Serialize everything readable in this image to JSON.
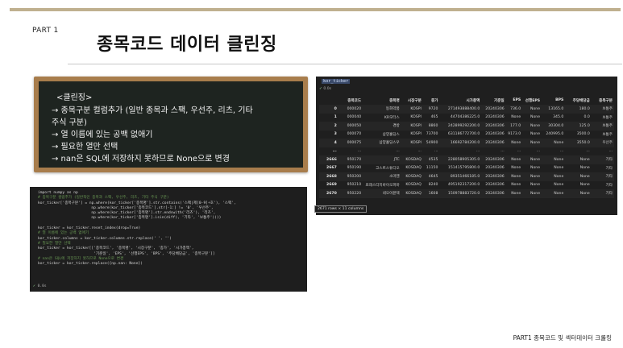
{
  "header": {
    "part": "PART 1",
    "title": "종목코드 데이터 클린징"
  },
  "board": {
    "lines": [
      "<클린징>",
      "→ 종목구분 컬럼추가 (일반 종목과 스팩, 우선주, 리츠, 기타",
      "주식 구분)",
      "→ 열 이름에 있는 공백 없애기",
      "→ 필요한 열만 선택",
      "→ nan은 SQL에 저장하지 못하므로 None으로 변경"
    ]
  },
  "code": {
    "lines": [
      "import numpy as np",
      "# 종목구분 컬럼추가 (일반적인 종목과 스팩, 우선주, 리츠, 기타 주식 구분)",
      "kor_ticker['종목구분'] = np.where(kor_ticker['종목명'].str.contains('스팩|제[0-9]+호'), '스팩',",
      "                        np.where(kor_ticker['종목코드'].str[-1:] != '0', '우선주',",
      "                        np.where(kor_ticker['종목명'].str.endswith('리츠'), '리츠',",
      "                        np.where(kor_ticker['종목명'].isin(diff), '기타', '보통주'))))",
      "",
      "kor_ticker = kor_ticker.reset_index(drop=True)",
      "# 열 이름에 있는 공백 없애기",
      "kor_ticker.columns = kor_ticker.columns.str.replace(' ', '')",
      "# 필요한 열만 선택",
      "kor_ticker = kor_ticker[['종목코드', '종목명', '시장구분', '종가', '시가총액',",
      "                         '기준일', 'EPS', '선행EPS', 'BPS', '주당배당금', '종목구분']]",
      "# nan은 SQL에 저장하지 못하므로 None으로 변경",
      "kor_ticker = kor_ticker.replace({np.nan: None})"
    ],
    "comment_lines": [
      1,
      8,
      10,
      13
    ],
    "status_check": "✓",
    "status_time": "0.0s"
  },
  "dataframe": {
    "cell_label": "kor_ticker",
    "status_check": "✓",
    "status_time": "0.0s",
    "columns": [
      "",
      "종목코드",
      "종목명",
      "시장구분",
      "종가",
      "시가총액",
      "기준일",
      "EPS",
      "선행EPS",
      "BPS",
      "주당배당금",
      "종목구분"
    ],
    "rows": [
      [
        "0",
        "000020",
        "동화약품",
        "KOSPI",
        "9720",
        "271493888400.0",
        "20240306",
        "736.0",
        "None",
        "13165.0",
        "180.0",
        "보통주"
      ],
      [
        "1",
        "000040",
        "KR모터스",
        "KOSPI",
        "465",
        "44704386225.0",
        "20240306",
        "None",
        "None",
        "345.0",
        "0.0",
        "보통주"
      ],
      [
        "2",
        "000050",
        "경방",
        "KOSPI",
        "8860",
        "242899292200.0",
        "20240306",
        "177.0",
        "None",
        "30304.0",
        "125.0",
        "보통주"
      ],
      [
        "3",
        "000070",
        "삼양홀딩스",
        "KOSPI",
        "73700",
        "631186772700.0",
        "20240306",
        "9173.0",
        "None",
        "240995.0",
        "3500.0",
        "보통주"
      ],
      [
        "4",
        "000075",
        "삼양홀딩스우",
        "KOSPI",
        "54900",
        "16692784200.0",
        "20240306",
        "None",
        "None",
        "None",
        "3550.0",
        "우선주"
      ],
      [
        "...",
        "...",
        "...",
        "...",
        "...",
        "...",
        "...",
        "...",
        "...",
        "...",
        "...",
        "..."
      ],
      [
        "2666",
        "950170",
        "JTC",
        "KOSDAQ",
        "4535",
        "228058905305.0",
        "20240306",
        "None",
        "None",
        "None",
        "None",
        "기타"
      ],
      [
        "2667",
        "950190",
        "고스트스튜디오",
        "KOSDAQ",
        "11150",
        "151415795800.0",
        "20240306",
        "None",
        "None",
        "None",
        "None",
        "기타"
      ],
      [
        "2668",
        "950200",
        "소마젠",
        "KOSDAQ",
        "4645",
        "89351466185.0",
        "20240306",
        "None",
        "None",
        "None",
        "None",
        "기타"
      ],
      [
        "2669",
        "950210",
        "프레스티지바이오파마",
        "KOSDAQ",
        "8240",
        "495192317200.0",
        "20240306",
        "None",
        "None",
        "None",
        "None",
        "기타"
      ],
      [
        "2670",
        "950220",
        "네오이뮨텍",
        "KOSDAQ",
        "1608",
        "150978883720.0",
        "20240306",
        "None",
        "None",
        "None",
        "None",
        "기타"
      ]
    ],
    "shape": "2671 rows × 11 columns"
  },
  "footer": {
    "text": "PART1 종목코드 및 섹터데이터 크롤링"
  },
  "colors": {
    "topbar": "#bfb08f",
    "board_frame": "#a87d4c",
    "board_surface": "#1e2420",
    "code_bg": "#1e1e1e",
    "df_bg": "#1f1f1f"
  }
}
